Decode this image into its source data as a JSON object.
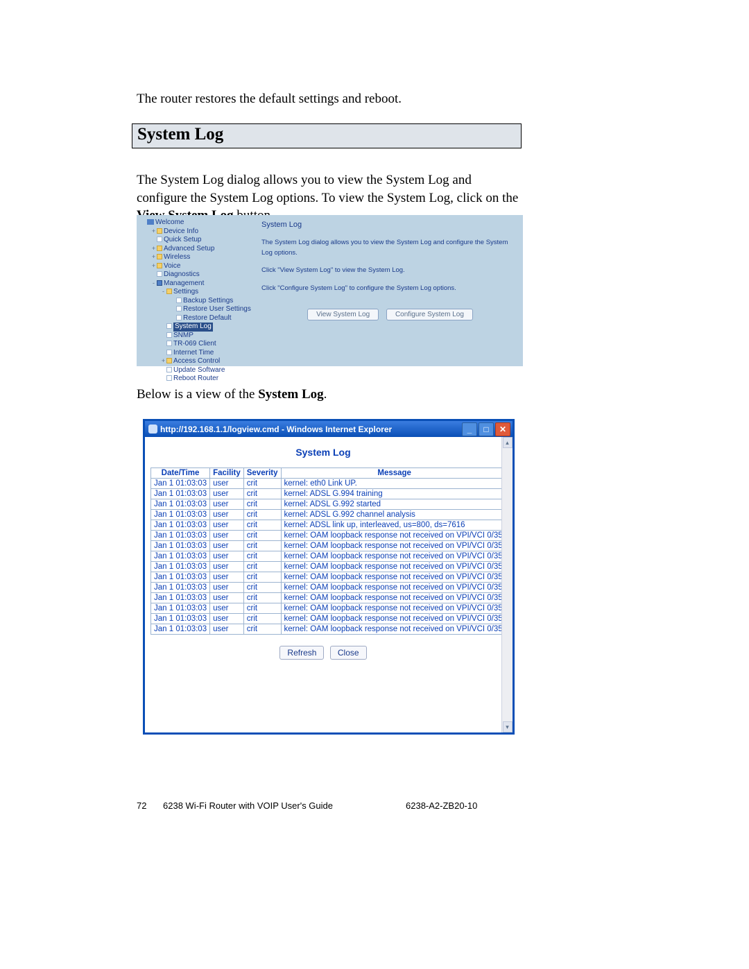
{
  "doc": {
    "para1": "The router restores the default settings and reboot.",
    "heading": "System Log",
    "para2_a": "The System Log dialog allows you to view the System Log and configure the System Log options.  To view the System Log, click on the ",
    "para2_b": "View System Log",
    "para2_c": " button.",
    "para3_a": "Below is a view of the ",
    "para3_b": "System Log",
    "para3_c": ".",
    "footer": {
      "page": "72",
      "title": "6238 Wi-Fi Router with VOIP User's Guide",
      "docnum": "6238-A2-ZB20-10"
    }
  },
  "router_ui": {
    "nav": [
      {
        "level": 0,
        "exp": "",
        "icon": "welcome",
        "label": "Welcome",
        "sel": false
      },
      {
        "level": 1,
        "exp": "+",
        "icon": "folder",
        "label": "Device Info",
        "sel": false
      },
      {
        "level": 1,
        "exp": "",
        "icon": "page",
        "label": "Quick Setup",
        "sel": false
      },
      {
        "level": 1,
        "exp": "+",
        "icon": "folder",
        "label": "Advanced Setup",
        "sel": false
      },
      {
        "level": 1,
        "exp": "+",
        "icon": "folder",
        "label": "Wireless",
        "sel": false
      },
      {
        "level": 1,
        "exp": "+",
        "icon": "folder",
        "label": "Voice",
        "sel": false
      },
      {
        "level": 1,
        "exp": "",
        "icon": "page",
        "label": "Diagnostics",
        "sel": false
      },
      {
        "level": 1,
        "exp": "-",
        "icon": "folder-sel",
        "label": "Management",
        "sel": false
      },
      {
        "level": 2,
        "exp": "-",
        "icon": "folder-o",
        "label": "Settings",
        "sel": false
      },
      {
        "level": 3,
        "exp": "",
        "icon": "page",
        "label": "Backup Settings",
        "sel": false
      },
      {
        "level": 3,
        "exp": "",
        "icon": "page",
        "label": "Restore User Settings",
        "sel": false
      },
      {
        "level": 3,
        "exp": "",
        "icon": "page",
        "label": "Restore Default",
        "sel": false
      },
      {
        "level": 2,
        "exp": "",
        "icon": "page",
        "label": "System Log",
        "sel": true
      },
      {
        "level": 2,
        "exp": "",
        "icon": "page",
        "label": "SNMP",
        "sel": false
      },
      {
        "level": 2,
        "exp": "",
        "icon": "page",
        "label": "TR-069 Client",
        "sel": false
      },
      {
        "level": 2,
        "exp": "",
        "icon": "page",
        "label": "Internet Time",
        "sel": false
      },
      {
        "level": 2,
        "exp": "+",
        "icon": "folder",
        "label": "Access Control",
        "sel": false
      },
      {
        "level": 2,
        "exp": "",
        "icon": "page",
        "label": "Update Software",
        "sel": false
      },
      {
        "level": 2,
        "exp": "",
        "icon": "page",
        "label": "Reboot Router",
        "sel": false
      }
    ],
    "panel": {
      "title": "System Log",
      "line1": "The System Log dialog allows you to view the System Log and configure the System Log options.",
      "line2": "Click \"View System Log\" to view the System Log.",
      "line3": "Click \"Configure System Log\" to configure the System Log options.",
      "btn_view": "View System Log",
      "btn_config": "Configure System Log"
    }
  },
  "log_window": {
    "titlebar": "http://192.168.1.1/logview.cmd - Windows Internet Explorer",
    "heading": "System Log",
    "columns": [
      "Date/Time",
      "Facility",
      "Severity",
      "Message"
    ],
    "rows": [
      {
        "dt": "Jan 1 01:03:03",
        "fac": "user",
        "sev": "crit",
        "msg": "kernel: eth0 Link UP."
      },
      {
        "dt": "Jan 1 01:03:03",
        "fac": "user",
        "sev": "crit",
        "msg": "kernel: ADSL G.994 training"
      },
      {
        "dt": "Jan 1 01:03:03",
        "fac": "user",
        "sev": "crit",
        "msg": "kernel: ADSL G.992 started"
      },
      {
        "dt": "Jan 1 01:03:03",
        "fac": "user",
        "sev": "crit",
        "msg": "kernel: ADSL G.992 channel analysis"
      },
      {
        "dt": "Jan 1 01:03:03",
        "fac": "user",
        "sev": "crit",
        "msg": "kernel: ADSL link up, interleaved, us=800, ds=7616"
      },
      {
        "dt": "Jan 1 01:03:03",
        "fac": "user",
        "sev": "crit",
        "msg": "kernel: OAM loopback response not received on VPI/VCI 0/35."
      },
      {
        "dt": "Jan 1 01:03:03",
        "fac": "user",
        "sev": "crit",
        "msg": "kernel: OAM loopback response not received on VPI/VCI 0/35."
      },
      {
        "dt": "Jan 1 01:03:03",
        "fac": "user",
        "sev": "crit",
        "msg": "kernel: OAM loopback response not received on VPI/VCI 0/35."
      },
      {
        "dt": "Jan 1 01:03:03",
        "fac": "user",
        "sev": "crit",
        "msg": "kernel: OAM loopback response not received on VPI/VCI 0/35."
      },
      {
        "dt": "Jan 1 01:03:03",
        "fac": "user",
        "sev": "crit",
        "msg": "kernel: OAM loopback response not received on VPI/VCI 0/35."
      },
      {
        "dt": "Jan 1 01:03:03",
        "fac": "user",
        "sev": "crit",
        "msg": "kernel: OAM loopback response not received on VPI/VCI 0/35."
      },
      {
        "dt": "Jan 1 01:03:03",
        "fac": "user",
        "sev": "crit",
        "msg": "kernel: OAM loopback response not received on VPI/VCI 0/35."
      },
      {
        "dt": "Jan 1 01:03:03",
        "fac": "user",
        "sev": "crit",
        "msg": "kernel: OAM loopback response not received on VPI/VCI 0/35."
      },
      {
        "dt": "Jan 1 01:03:03",
        "fac": "user",
        "sev": "crit",
        "msg": "kernel: OAM loopback response not received on VPI/VCI 0/35."
      },
      {
        "dt": "Jan 1 01:03:03",
        "fac": "user",
        "sev": "crit",
        "msg": "kernel: OAM loopback response not received on VPI/VCI 0/35."
      }
    ],
    "btn_refresh": "Refresh",
    "btn_close": "Close"
  }
}
